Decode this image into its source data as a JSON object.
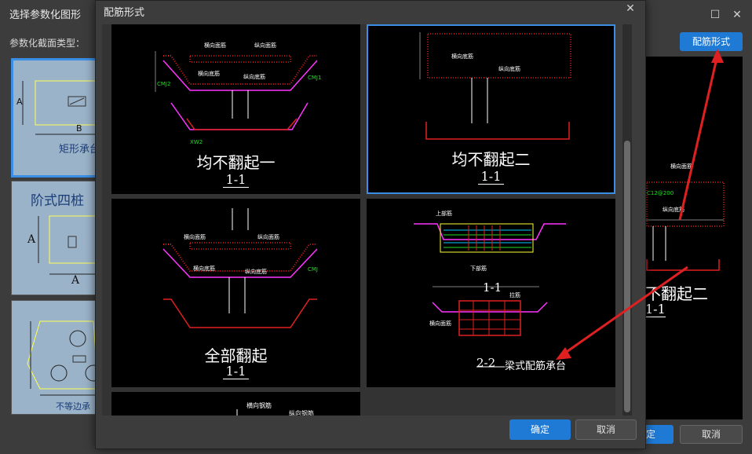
{
  "outer": {
    "title": "选择参数化图形",
    "section_label": "参数化截面类型：",
    "thumbs": [
      {
        "caption": "矩形承台",
        "dim_a": "A",
        "dim_b": "B"
      },
      {
        "caption": "阶式四桩",
        "dim_a": "A",
        "dim_b": "A"
      },
      {
        "caption": "不等边承台"
      }
    ],
    "rebar_form_button": "配筋形式",
    "preview_caption": "不翻起二",
    "preview_section": "1-1",
    "preview_labels": [
      "横向面筋",
      "纵向底筋",
      "C12@200"
    ],
    "confirm_button": "定",
    "cancel_button": "取消"
  },
  "inner": {
    "title": "配筋形式",
    "confirm_button": "确定",
    "cancel_button": "取消",
    "options": [
      {
        "title": "均不翻起一",
        "section": "1-1",
        "labels": [
          "横向面筋",
          "纵向面筋",
          "纵向底筋",
          "横向底筋",
          "CMJ2",
          "CMJ1",
          "XW2"
        ]
      },
      {
        "title": "均不翻起二",
        "section": "1-1",
        "labels": [
          "横向底筋",
          "纵向底筋"
        ]
      },
      {
        "title": "全部翻起",
        "section": "1-1",
        "labels": [
          "横向面筋",
          "纵向面筋",
          "横向底筋",
          "纵向底筋",
          "CMJ"
        ]
      },
      {
        "title": "梁式配筋承台",
        "section": "2-2",
        "labels": [
          "上部筋",
          "横向面筋",
          "下部筋",
          "拉筋"
        ],
        "section_top": "1-1"
      },
      {
        "title": "",
        "labels": [
          "横向钢筋",
          "纵向钢筋"
        ]
      }
    ]
  },
  "colors": {
    "accent": "#1f7ad6",
    "annotation_red": "#e02020"
  }
}
